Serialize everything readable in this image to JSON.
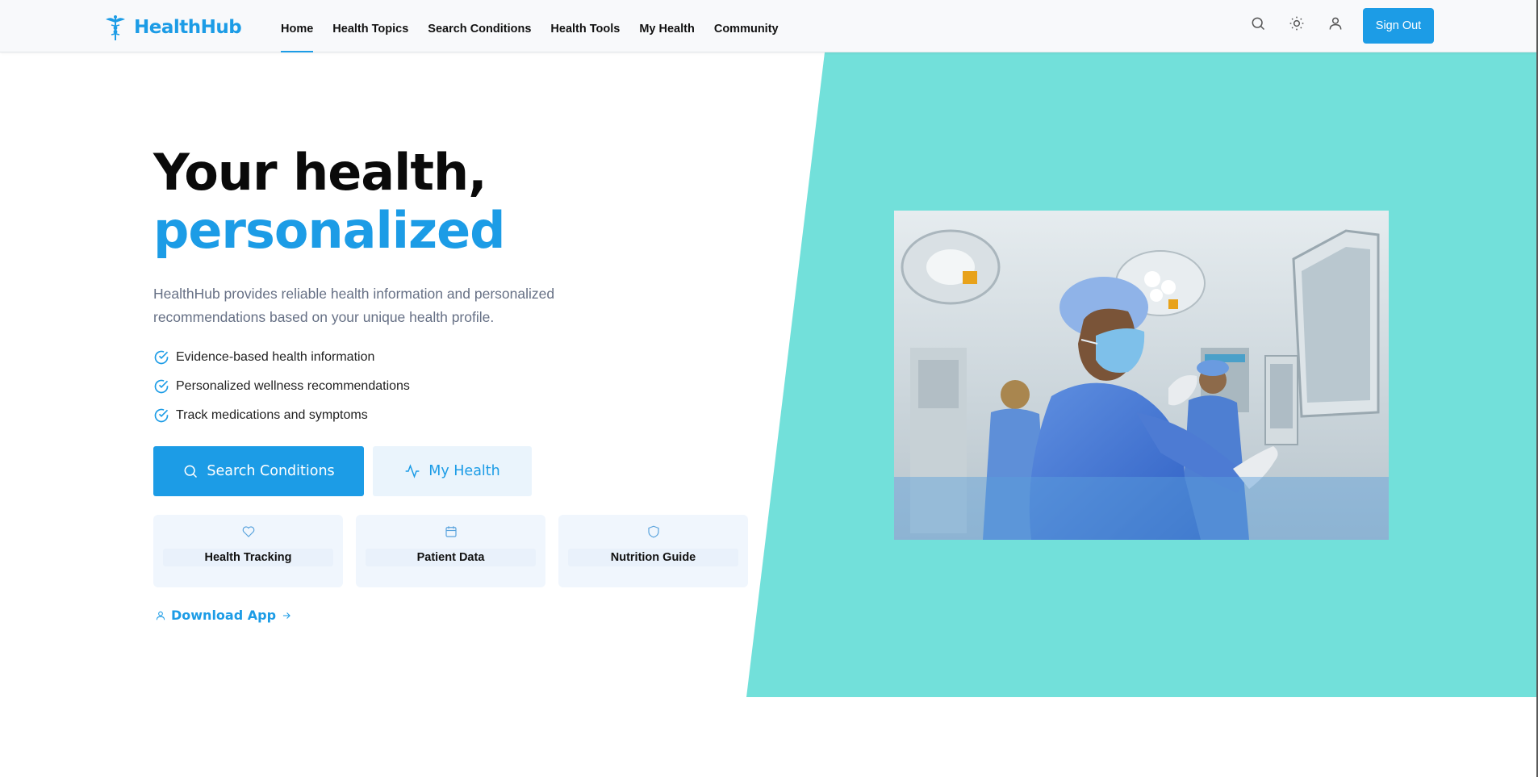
{
  "header": {
    "logo_text": "HealthHub",
    "nav": [
      "Home",
      "Health Topics",
      "Search Conditions",
      "Health Tools",
      "My Health",
      "Community"
    ],
    "active_nav": "Home",
    "icons": [
      "search-icon",
      "sun-icon",
      "user-icon"
    ],
    "signout_label": "Sign Out"
  },
  "hero": {
    "title_line1": "Your health,",
    "title_line2": "personalized",
    "description": "HealthHub provides reliable health information and personalized recommendations based on your unique health profile.",
    "features": [
      "Evidence-based health information",
      "Personalized wellness recommendations",
      "Track medications and symptoms"
    ],
    "primary_button": "Search Conditions",
    "secondary_button": "My Health",
    "cards": [
      {
        "label": "Health Tracking",
        "icon": "heart-icon"
      },
      {
        "label": "Patient Data",
        "icon": "calendar-icon"
      },
      {
        "label": "Nutrition Guide",
        "icon": "shield-icon"
      }
    ],
    "download_link": "Download App"
  },
  "colors": {
    "accent": "#1c9ce6",
    "teal_background": "#72e0da",
    "text_muted": "#667085"
  }
}
